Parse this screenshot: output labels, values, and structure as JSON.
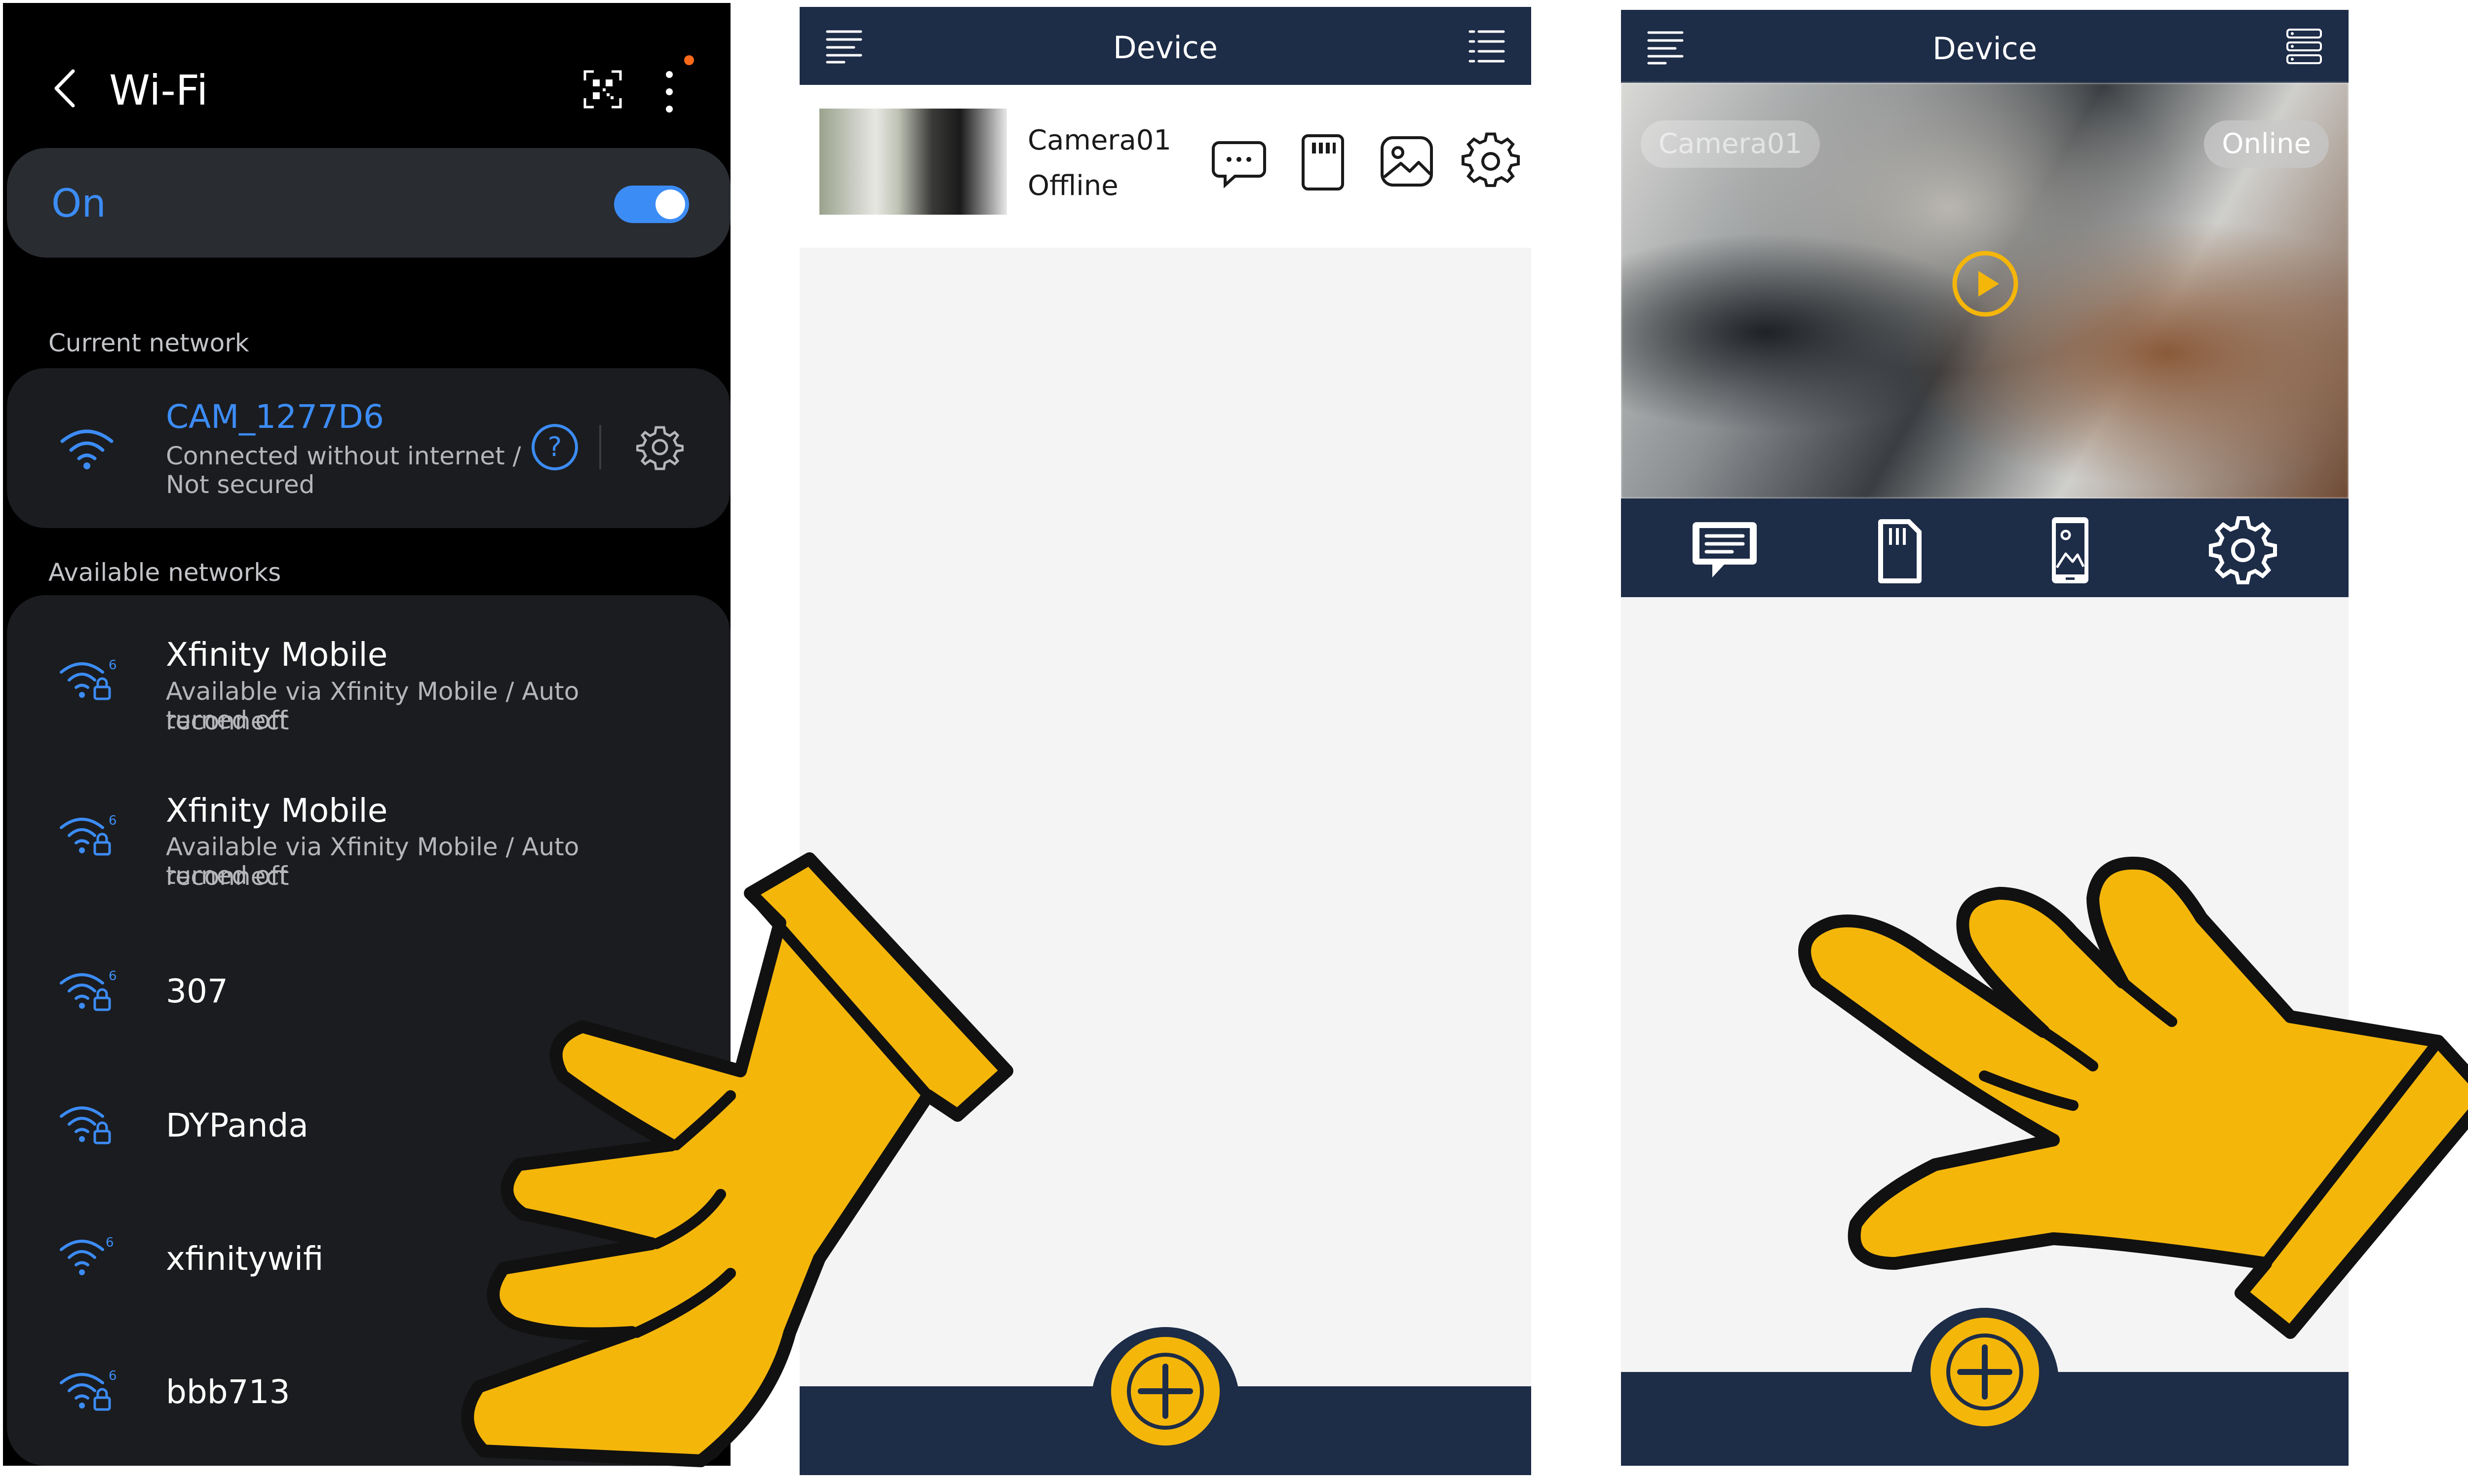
{
  "wifi_screen": {
    "title": "Wi-Fi",
    "toggle_label": "On",
    "toggle_on": true,
    "current_network_label": "Current network",
    "current_network": {
      "name": "CAM_1277D6",
      "status_line1": "Connected without internet /",
      "status_line2": "Not secured"
    },
    "available_networks_label": "Available networks",
    "networks": [
      {
        "name": "Xfinity Mobile",
        "sub1": "Available via Xfinity Mobile / Auto reconnect",
        "sub2": "turned off"
      },
      {
        "name": "Xfinity Mobile",
        "sub1": "Available via Xfinity Mobile / Auto reconnect",
        "sub2": "turned off"
      },
      {
        "name": "307"
      },
      {
        "name": "DYPanda"
      },
      {
        "name": "xfinitywifi"
      },
      {
        "name": "bbb713"
      }
    ],
    "colors": {
      "accent": "#3c8cf5",
      "background": "#000000",
      "card": "#1b1c1f",
      "notification_dot": "#ff6a1a"
    }
  },
  "device_list_screen": {
    "title": "Device",
    "camera_name": "Camera01",
    "camera_status": "Offline",
    "row_icons": [
      "message-icon",
      "sd-card-icon",
      "gallery-icon",
      "gear-icon"
    ],
    "colors": {
      "nav": "#1d2c47",
      "add_button": "#f5b60a"
    }
  },
  "device_live_screen": {
    "title": "Device",
    "camera_name": "Camera01",
    "camera_status": "Online",
    "action_icons": [
      "message-icon",
      "sd-card-icon",
      "phone-gallery-icon",
      "gear-icon"
    ]
  },
  "hands": [
    "pointing-hand-icon",
    "pointing-hand-icon"
  ]
}
